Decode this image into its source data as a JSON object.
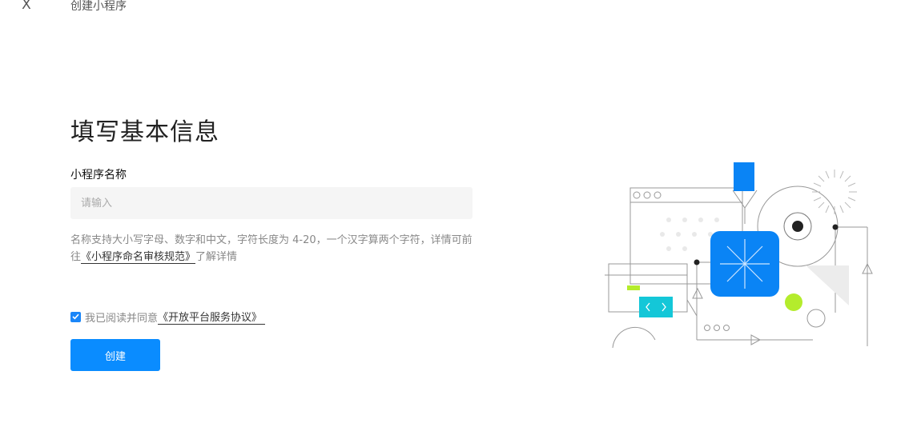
{
  "header": {
    "close_icon_glyph": "X",
    "title": "创建小程序"
  },
  "form": {
    "heading": "填写基本信息",
    "name_label": "小程序名称",
    "name_placeholder": "请输入",
    "name_value": "",
    "hint_text": "名称支持大小写字母、数字和中文，字符长度为 4-20，一个汉字算两个字符，详情可前往",
    "hint_link": "《小程序命名审核规范》",
    "hint_suffix": "了解详情",
    "agree_checked": true,
    "agree_text": "我已阅读并同意",
    "agree_link": "《开放平台服务协议》",
    "submit_label": "创建"
  },
  "colors": {
    "primary": "#0a8cff",
    "checkbox": "#1a86f8",
    "illus_blue": "#0a84f5",
    "illus_cyan": "#14c7d8",
    "illus_lime": "#b4ec2c"
  },
  "icons": {
    "close": "close-icon",
    "check": "checkmark-icon",
    "illustration": "mini-program-illustration"
  }
}
